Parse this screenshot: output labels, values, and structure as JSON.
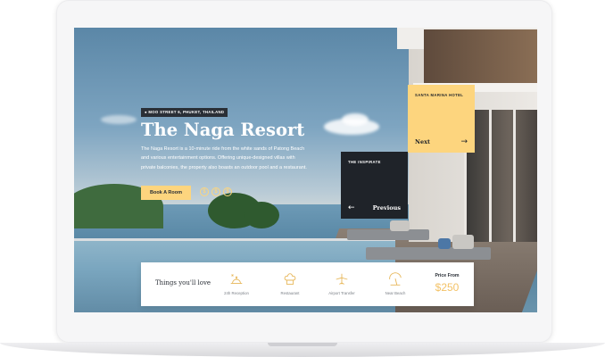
{
  "hero": {
    "address": "MOO STREET 6, PHUKET, THAILAND",
    "title": "The Naga Resort",
    "description": "The Naga Resort is a 10-minute ride from the white sands of Patong Beach and various entertainment options. Offering unique-designed villas with private balconies, the property also boasts an outdoor pool and a restaurant.",
    "book_button": "Book A Room",
    "price_symbols": [
      "$",
      "$",
      "$"
    ]
  },
  "cards": {
    "next": {
      "tag": "SANTA MARINA HOTEL",
      "label": "Next",
      "arrow": "→"
    },
    "previous": {
      "tag": "THE INSPIRATE",
      "label": "Previous",
      "arrow": "←"
    }
  },
  "amenities": {
    "heading": "Things you'll love",
    "items": [
      {
        "label": "24h Reception",
        "icon": "reception-bell-icon"
      },
      {
        "label": "Restaurant",
        "icon": "chef-hat-icon"
      },
      {
        "label": "Airport Transfer",
        "icon": "airplane-icon"
      },
      {
        "label": "Near Beach",
        "icon": "beach-umbrella-icon"
      }
    ],
    "price_label": "Price From",
    "price_value": "$250"
  },
  "colors": {
    "accent": "#fdd57e",
    "dark": "#1f2329",
    "price": "#f3c267",
    "icon_stroke": "#e7b75a"
  }
}
